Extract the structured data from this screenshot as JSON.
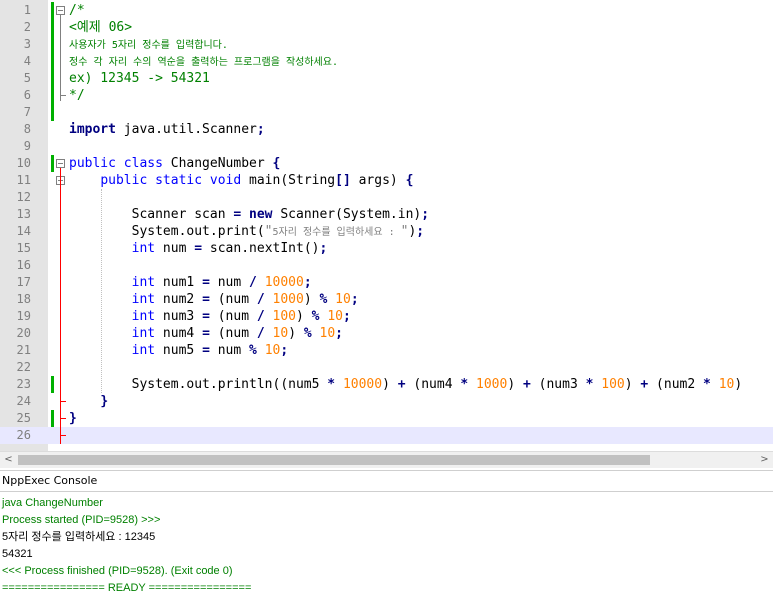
{
  "editor": {
    "lines": [
      {
        "n": "1",
        "segs": [
          {
            "t": "/*",
            "c": "cm"
          }
        ]
      },
      {
        "n": "2",
        "segs": [
          {
            "t": "<예제 06>",
            "c": "cm"
          }
        ]
      },
      {
        "n": "3",
        "segs": [
          {
            "t": "사용자가 5자리 정수를 입력합니다.",
            "c": "cm korean-small"
          }
        ]
      },
      {
        "n": "4",
        "segs": [
          {
            "t": "정수 각 자리 수의 역순을 출력하는 프로그램을 작성하세요.",
            "c": "cm korean-small"
          }
        ]
      },
      {
        "n": "5",
        "segs": [
          {
            "t": "ex) 12345 -> 54321",
            "c": "cm"
          }
        ]
      },
      {
        "n": "6",
        "segs": [
          {
            "t": "*/",
            "c": "cm"
          }
        ]
      },
      {
        "n": "7",
        "segs": []
      },
      {
        "n": "8",
        "segs": [
          {
            "t": "import",
            "c": "kwb"
          },
          {
            "t": " java.util.Scanner"
          },
          {
            "t": ";",
            "c": "op"
          }
        ]
      },
      {
        "n": "9",
        "segs": []
      },
      {
        "n": "10",
        "segs": [
          {
            "t": "public class",
            "c": "kw"
          },
          {
            "t": " ChangeNumber "
          },
          {
            "t": "{",
            "c": "op"
          }
        ]
      },
      {
        "n": "11",
        "segs": [
          {
            "t": "    "
          },
          {
            "t": "public static void",
            "c": "kw"
          },
          {
            "t": " main(String"
          },
          {
            "t": "[]",
            "c": "op"
          },
          {
            "t": " args) "
          },
          {
            "t": "{",
            "c": "op"
          }
        ]
      },
      {
        "n": "12",
        "segs": []
      },
      {
        "n": "13",
        "segs": [
          {
            "t": "        Scanner scan "
          },
          {
            "t": "=",
            "c": "op"
          },
          {
            "t": " "
          },
          {
            "t": "new",
            "c": "kwb"
          },
          {
            "t": " Scanner(System.in)"
          },
          {
            "t": ";",
            "c": "op"
          }
        ]
      },
      {
        "n": "14",
        "segs": [
          {
            "t": "        System.out.print("
          },
          {
            "t": "\"",
            "c": "str"
          },
          {
            "t": "5자리 정수를 입력하세요 : ",
            "c": "str korean-small"
          },
          {
            "t": "\"",
            "c": "str"
          },
          {
            "t": ")"
          },
          {
            "t": ";",
            "c": "op"
          }
        ]
      },
      {
        "n": "15",
        "segs": [
          {
            "t": "        "
          },
          {
            "t": "int",
            "c": "kw"
          },
          {
            "t": " num "
          },
          {
            "t": "=",
            "c": "op"
          },
          {
            "t": " scan.nextInt()"
          },
          {
            "t": ";",
            "c": "op"
          }
        ]
      },
      {
        "n": "16",
        "segs": []
      },
      {
        "n": "17",
        "segs": [
          {
            "t": "        "
          },
          {
            "t": "int",
            "c": "kw"
          },
          {
            "t": " num1 "
          },
          {
            "t": "=",
            "c": "op"
          },
          {
            "t": " num "
          },
          {
            "t": "/",
            "c": "op"
          },
          {
            "t": " "
          },
          {
            "t": "10000",
            "c": "num"
          },
          {
            "t": ";",
            "c": "op"
          }
        ]
      },
      {
        "n": "18",
        "segs": [
          {
            "t": "        "
          },
          {
            "t": "int",
            "c": "kw"
          },
          {
            "t": " num2 "
          },
          {
            "t": "=",
            "c": "op"
          },
          {
            "t": " (num "
          },
          {
            "t": "/",
            "c": "op"
          },
          {
            "t": " "
          },
          {
            "t": "1000",
            "c": "num"
          },
          {
            "t": ") "
          },
          {
            "t": "%",
            "c": "op"
          },
          {
            "t": " "
          },
          {
            "t": "10",
            "c": "num"
          },
          {
            "t": ";",
            "c": "op"
          }
        ]
      },
      {
        "n": "19",
        "segs": [
          {
            "t": "        "
          },
          {
            "t": "int",
            "c": "kw"
          },
          {
            "t": " num3 "
          },
          {
            "t": "=",
            "c": "op"
          },
          {
            "t": " (num "
          },
          {
            "t": "/",
            "c": "op"
          },
          {
            "t": " "
          },
          {
            "t": "100",
            "c": "num"
          },
          {
            "t": ") "
          },
          {
            "t": "%",
            "c": "op"
          },
          {
            "t": " "
          },
          {
            "t": "10",
            "c": "num"
          },
          {
            "t": ";",
            "c": "op"
          }
        ]
      },
      {
        "n": "20",
        "segs": [
          {
            "t": "        "
          },
          {
            "t": "int",
            "c": "kw"
          },
          {
            "t": " num4 "
          },
          {
            "t": "=",
            "c": "op"
          },
          {
            "t": " (num "
          },
          {
            "t": "/",
            "c": "op"
          },
          {
            "t": " "
          },
          {
            "t": "10",
            "c": "num"
          },
          {
            "t": ") "
          },
          {
            "t": "%",
            "c": "op"
          },
          {
            "t": " "
          },
          {
            "t": "10",
            "c": "num"
          },
          {
            "t": ";",
            "c": "op"
          }
        ]
      },
      {
        "n": "21",
        "segs": [
          {
            "t": "        "
          },
          {
            "t": "int",
            "c": "kw"
          },
          {
            "t": " num5 "
          },
          {
            "t": "=",
            "c": "op"
          },
          {
            "t": " num "
          },
          {
            "t": "%",
            "c": "op"
          },
          {
            "t": " "
          },
          {
            "t": "10",
            "c": "num"
          },
          {
            "t": ";",
            "c": "op"
          }
        ]
      },
      {
        "n": "22",
        "segs": []
      },
      {
        "n": "23",
        "segs": [
          {
            "t": "        System.out.println((num5 "
          },
          {
            "t": "*",
            "c": "op"
          },
          {
            "t": " "
          },
          {
            "t": "10000",
            "c": "num"
          },
          {
            "t": ") "
          },
          {
            "t": "+",
            "c": "op"
          },
          {
            "t": " (num4 "
          },
          {
            "t": "*",
            "c": "op"
          },
          {
            "t": " "
          },
          {
            "t": "1000",
            "c": "num"
          },
          {
            "t": ") "
          },
          {
            "t": "+",
            "c": "op"
          },
          {
            "t": " (num3 "
          },
          {
            "t": "*",
            "c": "op"
          },
          {
            "t": " "
          },
          {
            "t": "100",
            "c": "num"
          },
          {
            "t": ") "
          },
          {
            "t": "+",
            "c": "op"
          },
          {
            "t": " (num2 "
          },
          {
            "t": "*",
            "c": "op"
          },
          {
            "t": " "
          },
          {
            "t": "10",
            "c": "num"
          },
          {
            "t": ")"
          }
        ]
      },
      {
        "n": "24",
        "segs": [
          {
            "t": "    "
          },
          {
            "t": "}",
            "c": "op"
          }
        ]
      },
      {
        "n": "25",
        "segs": [
          {
            "t": "}",
            "c": "op"
          }
        ]
      },
      {
        "n": "26",
        "segs": []
      }
    ]
  },
  "scrollbar": {
    "left_arrow": "<",
    "right_arrow": ">"
  },
  "console": {
    "title": "NppExec Console",
    "lines": [
      {
        "text": "java ChangeNumber",
        "color": "#008000"
      },
      {
        "text": "Process started (PID=9528) >>>",
        "color": "#008000"
      },
      {
        "text": "5자리 정수를 입력하세요 : 12345",
        "color": "#000000"
      },
      {
        "text": "54321",
        "color": "#000000"
      },
      {
        "text": "<<< Process finished (PID=9528). (Exit code 0)",
        "color": "#008000"
      },
      {
        "text": "================ READY ================",
        "color": "#008000"
      }
    ]
  },
  "colors": {
    "keyword": "#0000ff",
    "number": "#ff8000",
    "comment": "#008000",
    "operator": "#000080",
    "string": "#808080",
    "current_line": "#e8e8ff",
    "change_marker": "#00b000",
    "fold_line": "#ff0000"
  }
}
